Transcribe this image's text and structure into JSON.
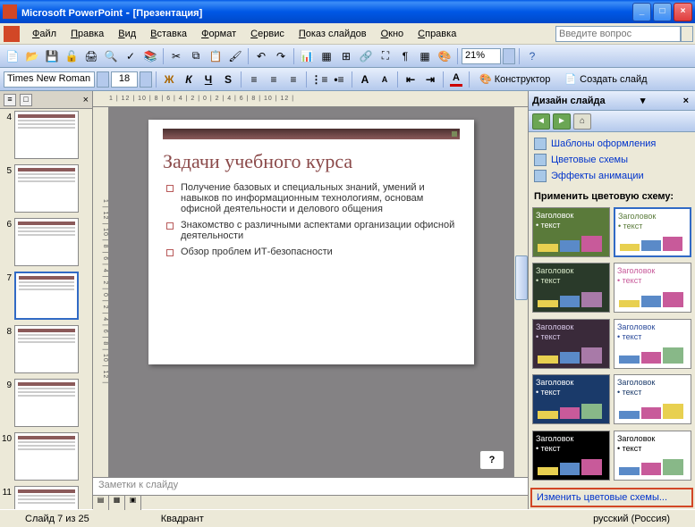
{
  "titlebar": {
    "app": "Microsoft PowerPoint",
    "doc": "[Презентация]"
  },
  "menu": [
    "Файл",
    "Правка",
    "Вид",
    "Вставка",
    "Формат",
    "Сервис",
    "Показ слайдов",
    "Окно",
    "Справка"
  ],
  "question_placeholder": "Введите вопрос",
  "zoom": "21%",
  "font": {
    "name": "Times New Roman",
    "size": "18"
  },
  "fmt_labels": {
    "designer": "Конструктор",
    "new_slide": "Создать слайд"
  },
  "thumbs": [
    4,
    5,
    6,
    7,
    8,
    9,
    10,
    11
  ],
  "selected_thumb": 7,
  "ruler": "1 | 12 | 10 | 8 | 6 | 4 | 2 | 0 | 2 | 4 | 6 | 8 | 10 | 12 |",
  "slide": {
    "title": "Задачи учебного курса",
    "bullets": [
      "Получение базовых и специальных знаний, умений и навыков по информационным технологиям, основам офисной деятельности и делового общения",
      "Знакомство с различными аспектами организации офисной деятельности",
      "Обзор проблем ИТ-безопасности"
    ]
  },
  "help": "?",
  "notes": "Заметки к слайду",
  "taskpane": {
    "title": "Дизайн слайда",
    "links": [
      "Шаблоны оформления",
      "Цветовые схемы",
      "Эффекты анимации"
    ],
    "section": "Применить цветовую схему:",
    "scheme_label_head": "Заголовок",
    "scheme_label_sub": "текст",
    "footer": "Изменить цветовые схемы..."
  },
  "schemes": [
    {
      "bg": "#5a7a3a",
      "fg": "#ffffff",
      "bars": [
        "#e8d050",
        "#5a8ac8",
        "#c85a9a"
      ]
    },
    {
      "bg": "#ffffff",
      "fg": "#5a7a3a",
      "bars": [
        "#e8d050",
        "#5a8ac8",
        "#c85a9a"
      ],
      "sel": true
    },
    {
      "bg": "#2a3a2a",
      "fg": "#d8e8c8",
      "bars": [
        "#e8d050",
        "#5a8ac8",
        "#a87aa8"
      ]
    },
    {
      "bg": "#ffffff",
      "fg": "#c85a9a",
      "bars": [
        "#e8d050",
        "#5a8ac8",
        "#c85a9a"
      ]
    },
    {
      "bg": "#3a2a3a",
      "fg": "#d8c8e8",
      "bars": [
        "#e8d050",
        "#5a8ac8",
        "#a87aa8"
      ]
    },
    {
      "bg": "#ffffff",
      "fg": "#2a4a9a",
      "bars": [
        "#5a8ac8",
        "#c85a9a",
        "#88b888"
      ]
    },
    {
      "bg": "#1a3a6a",
      "fg": "#ffffff",
      "bars": [
        "#e8d050",
        "#c85a9a",
        "#88b888"
      ]
    },
    {
      "bg": "#ffffff",
      "fg": "#1a3a6a",
      "bars": [
        "#5a8ac8",
        "#c85a9a",
        "#e8d050"
      ]
    },
    {
      "bg": "#000000",
      "fg": "#ffffff",
      "bars": [
        "#e8d050",
        "#5a8ac8",
        "#c85a9a"
      ]
    },
    {
      "bg": "#ffffff",
      "fg": "#000000",
      "bars": [
        "#5a8ac8",
        "#c85a9a",
        "#88b888"
      ]
    }
  ],
  "status": {
    "slide": "Слайд 7 из 25",
    "layout": "Квадрант",
    "lang": "русский (Россия)"
  }
}
